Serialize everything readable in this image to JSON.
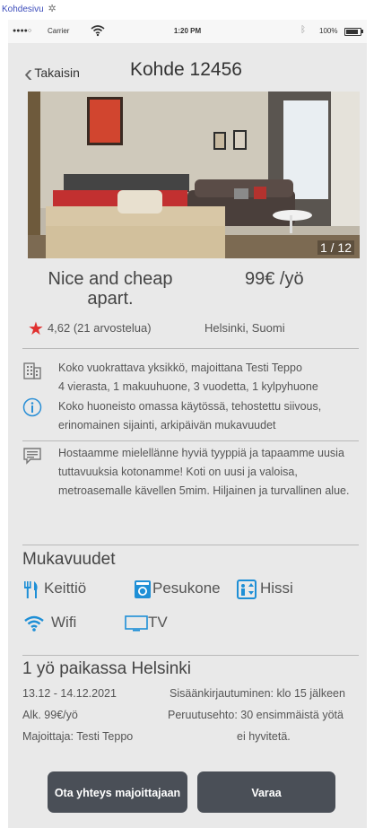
{
  "window": {
    "title": "Kohdesivu"
  },
  "statusbar": {
    "carrier": "Carrier",
    "time": "1:20 PM",
    "battery": "100%"
  },
  "header": {
    "back_label": "Takaisin",
    "title": "Kohde 12456"
  },
  "photo": {
    "counter": "1 / 12"
  },
  "listing": {
    "name": "Nice and cheap apart.",
    "price": "99€ /yö",
    "rating": "4,62 (21 arvostelua)",
    "location": "Helsinki, Suomi"
  },
  "details": {
    "line1": "Koko vuokrattava yksikkö, majoittana Testi Teppo",
    "line2": "4 vierasta, 1 makuuhuone, 3 vuodetta, 1 kylpyhuone",
    "info": "Koko huoneisto omassa käytössä, tehostettu siivous, erinomainen sijainti, arkipäivän mukavuudet",
    "message": "Hostaamme mielellänne hyviä tyyppiä ja tapaamme uusia tuttavuuksia kotonamme! Koti on uusi ja valoisa, metroasemalle kävellen 5mim. Hiljainen ja turvallinen alue."
  },
  "amenities": {
    "title": "Mukavuudet",
    "items": [
      {
        "label": "Keittiö",
        "icon": "fork-knife-icon"
      },
      {
        "label": "Pesukone",
        "icon": "washing-machine-icon"
      },
      {
        "label": "Hissi",
        "icon": "elevator-icon"
      },
      {
        "label": "Wifi",
        "icon": "wifi-icon"
      },
      {
        "label": "TV",
        "icon": "tv-icon"
      }
    ],
    "accent_color": "#1e8fd6"
  },
  "stay": {
    "title": "1 yö paikassa Helsinki",
    "dates": "13.12 - 14.12.2021",
    "price": "Alk. 99€/yö",
    "host": "Majoittaja: Testi Teppo",
    "checkin": "Sisäänkirjautuminen: klo 15 jälkeen",
    "cancellation_1": "Peruutusehto: 30 ensimmäistä yötä",
    "cancellation_2": "ei hyvitetä."
  },
  "actions": {
    "contact_label": "Ota yhteys majoittajaan",
    "book_label": "Varaa"
  }
}
